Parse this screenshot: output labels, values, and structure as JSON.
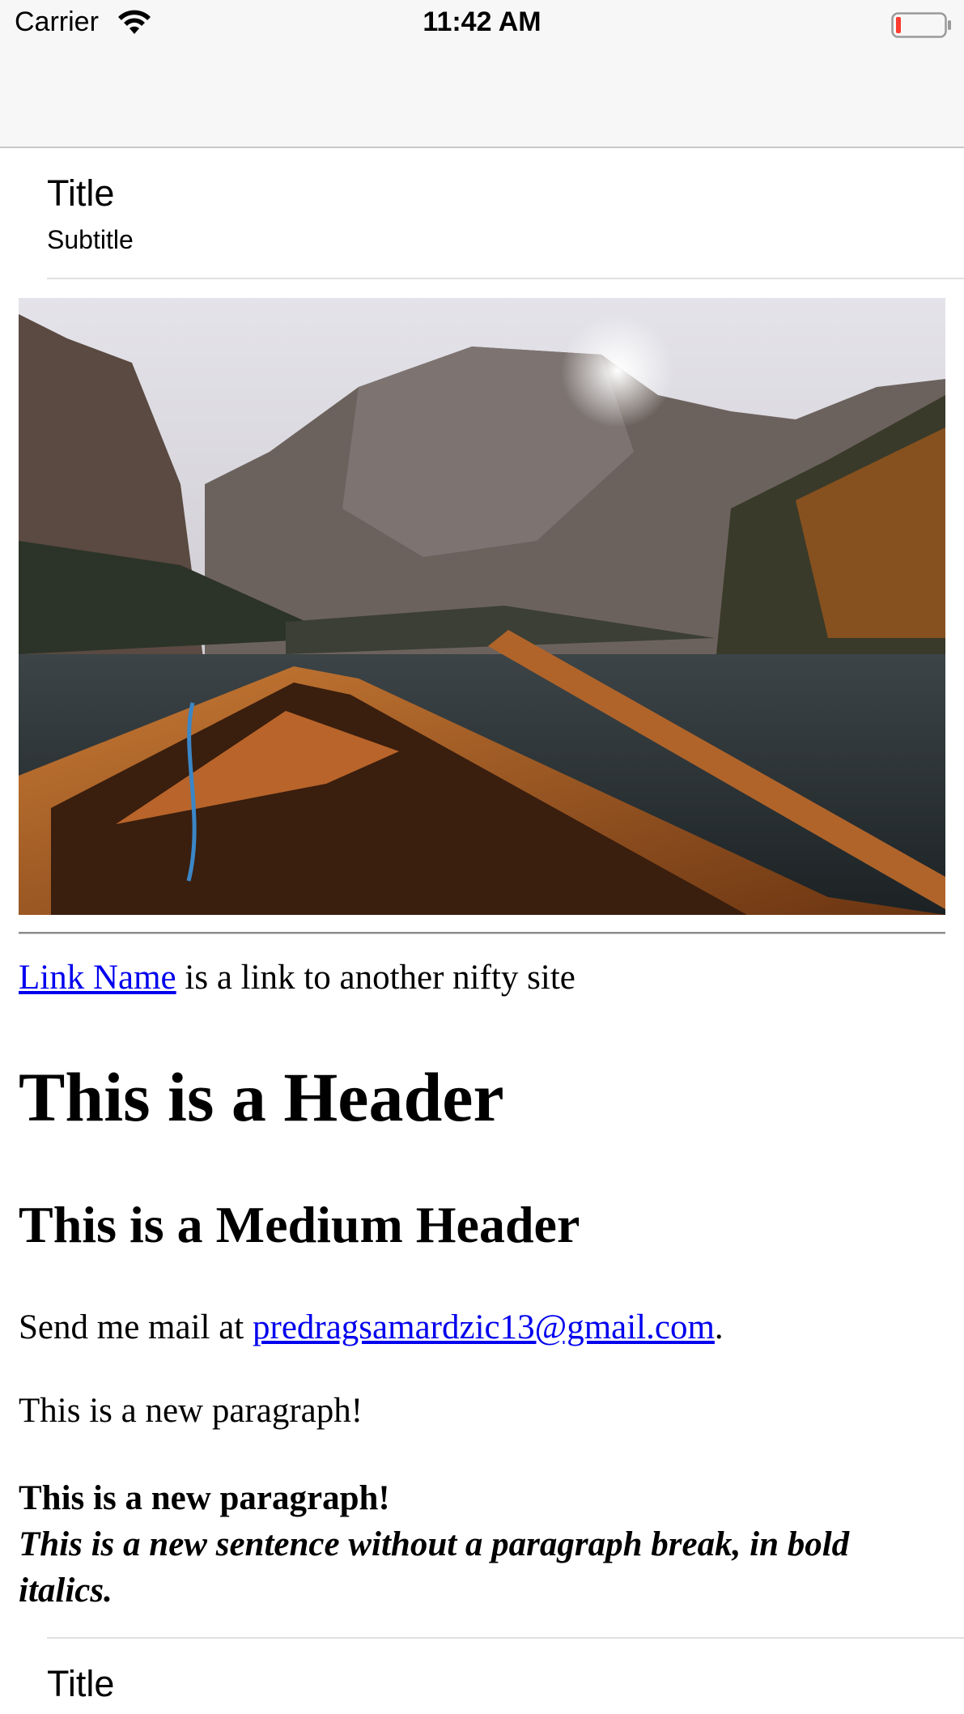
{
  "status_bar": {
    "carrier": "Carrier",
    "time": "11:42 AM",
    "battery_color": "#ff3b30"
  },
  "header_cell": {
    "title": "Title",
    "subtitle": "Subtitle"
  },
  "image": {
    "icon": "mountain-lake-rowboat-photo"
  },
  "html": {
    "link_name": "Link Name",
    "link_suffix": " is a link to another nifty site",
    "header": "This is a Header",
    "medium_header": "This is a Medium Header",
    "mail_prefix": "Send me mail at ",
    "mail_address": "predragsamardzic13@gmail.com",
    "mail_suffix": ".",
    "new_paragraph": "This is a new paragraph!",
    "bold_paragraph": "This is a new paragraph!",
    "bold_italic_sentence": "This is a new sentence without a paragraph break, in bold italics.",
    "link_color": "#0000ee"
  },
  "footer_cell": {
    "title": "Title"
  }
}
